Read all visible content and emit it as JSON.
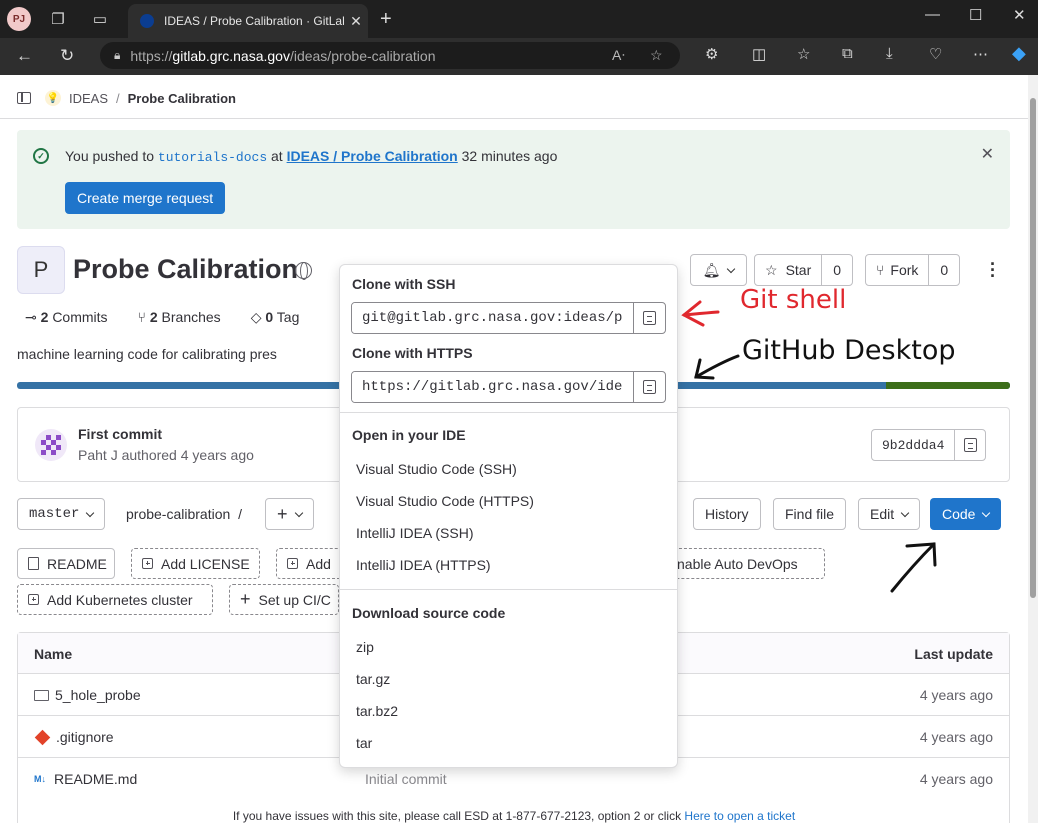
{
  "browser": {
    "profile_initials": "PJ",
    "tab_title": "IDEAS / Probe Calibration · GitLab",
    "url_prefix": "https://",
    "url_host": "gitlab.grc.nasa.gov",
    "url_path": "/ideas/probe-calibration"
  },
  "breadcrumb": {
    "group": "IDEAS",
    "separator": "/",
    "project": "Probe Calibration"
  },
  "alert": {
    "prefix": "You pushed to ",
    "branch": "tutorials-docs",
    "mid": " at ",
    "project_link": "IDEAS / Probe Calibration",
    "suffix": " 32 minutes ago",
    "button": "Create merge request"
  },
  "project": {
    "avatar_letter": "P",
    "title": "Probe Calibration",
    "star_label": "Star",
    "star_count": "0",
    "fork_label": "Fork",
    "fork_count": "0",
    "description": "machine learning code for calibrating pres"
  },
  "stats": {
    "commits_count": "2",
    "commits_label": "Commits",
    "branches_count": "2",
    "branches_label": "Branches",
    "tags_count": "0",
    "tags_label": "Tag"
  },
  "last_commit": {
    "title": "First commit",
    "meta": "Paht J authored 4 years ago",
    "sha": "9b2ddda4"
  },
  "repo_toolbar": {
    "branch": "master",
    "path": "probe-calibration",
    "path_sep": "/",
    "history": "History",
    "find_file": "Find file",
    "edit": "Edit",
    "code": "Code"
  },
  "quick_actions": {
    "readme": "README",
    "add_license": "Add LICENSE",
    "add_partial": "Add",
    "auto_devops": "nable Auto DevOps",
    "add_k8s": "Add Kubernetes cluster",
    "setup_ci": "Set up CI/C"
  },
  "files_table": {
    "col_name": "Name",
    "col_update": "Last update",
    "rows": [
      {
        "name": "5_hole_probe",
        "updated": "4 years ago"
      },
      {
        "name": ".gitignore",
        "updated": "4 years ago"
      },
      {
        "name": "README.md",
        "updated": "4 years ago"
      }
    ],
    "hidden_commit": "Initial commit"
  },
  "clone_dropdown": {
    "ssh_heading": "Clone with SSH",
    "ssh_url": "git@gitlab.grc.nasa.gov:ideas/probe-calibration.git",
    "https_heading": "Clone with HTTPS",
    "https_url": "https://gitlab.grc.nasa.gov/ideas/probe-calibration.git",
    "ide_heading": "Open in your IDE",
    "ide_options": [
      "Visual Studio Code (SSH)",
      "Visual Studio Code (HTTPS)",
      "IntelliJ IDEA (SSH)",
      "IntelliJ IDEA (HTTPS)"
    ],
    "download_heading": "Download source code",
    "download_options": [
      "zip",
      "tar.gz",
      "tar.bz2",
      "tar"
    ]
  },
  "annotations": {
    "git_shell": "Git shell",
    "github_desktop": "GitHub Desktop",
    "red": "#e0282e",
    "black": "#111111"
  },
  "footer": {
    "text": "If you have issues with this site, please call ESD at 1-877-677-2123, option 2 or click ",
    "link": "Here to open a ticket"
  },
  "colors": {
    "primary": "#1f75cb",
    "alert_bg": "#ecf4ee",
    "success": "#217645"
  }
}
